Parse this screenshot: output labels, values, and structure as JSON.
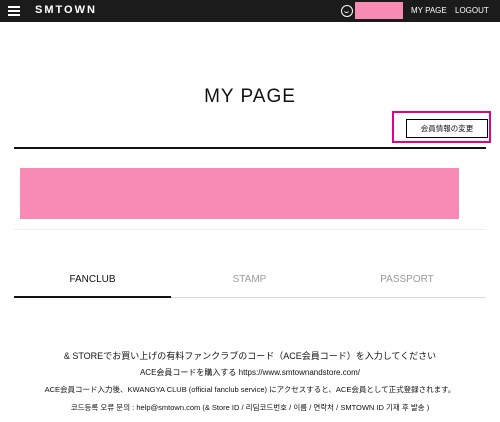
{
  "header": {
    "logo": "SMTOWN",
    "links": {
      "mypage": "MY PAGE",
      "logout": "LOGOUT"
    }
  },
  "page": {
    "title": "MY PAGE",
    "edit_button": "会員情報の変更"
  },
  "tabs": [
    {
      "label": "FANCLUB",
      "active": true
    },
    {
      "label": "STAMP",
      "active": false
    },
    {
      "label": "PASSPORT",
      "active": false
    }
  ],
  "notice": {
    "line1": "& STOREでお買い上げの有料ファンクラブのコード（ACE会員コード）を入力してください",
    "line2": "ACE会員コードを購入する https://www.smtownandstore.com/",
    "line3": "ACE会員コード入力後、KWANGYA CLUB (official fanclub service) にアクセスすると、ACE会員として正式登録されます。",
    "line4": "코드등록 오류 문의 : help@smtown.com (& Store ID / 리딤코드번호 / 이름 / 연락처 / SMTOWN ID 기재 후 발송 )"
  },
  "colors": {
    "topbar": "#1b1b1b",
    "highlight": "#e60082",
    "redaction": "#f78bb6"
  },
  "icons": [
    "hamburger-menu-icon",
    "user-icon"
  ]
}
